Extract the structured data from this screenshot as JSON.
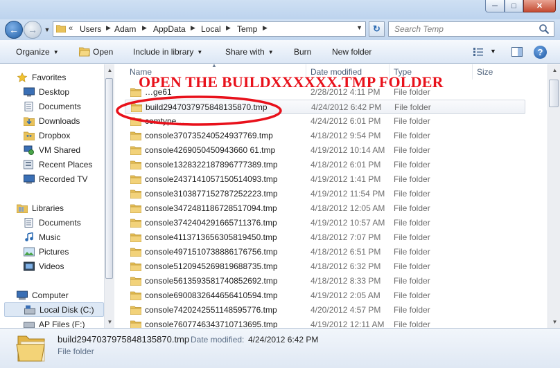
{
  "colors": {
    "annotation": "#e8111b",
    "folder": "#e9c25a",
    "chrome": "#c9dcf2"
  },
  "window": {
    "min_icon": "minimize-icon",
    "max_icon": "maximize-icon",
    "close_icon": "close-icon"
  },
  "address": {
    "overflow": "«",
    "crumbs": [
      "Users",
      "Adam",
      "AppData",
      "Local",
      "Temp"
    ]
  },
  "search": {
    "placeholder": "Search Temp"
  },
  "toolbar": {
    "organize": "Organize",
    "open": "Open",
    "include": "Include in library",
    "share": "Share with",
    "burn": "Burn",
    "new_folder": "New folder"
  },
  "nav": {
    "favorites": {
      "header": "Favorites",
      "items": [
        "Desktop",
        "Documents",
        "Downloads",
        "Dropbox",
        "VM Shared",
        "Recent Places",
        "Recorded TV"
      ]
    },
    "libraries": {
      "header": "Libraries",
      "items": [
        "Documents",
        "Music",
        "Pictures",
        "Videos"
      ]
    },
    "computer": {
      "header": "Computer",
      "items": [
        "Local Disk (C:)",
        "AP Files (F:)"
      ]
    }
  },
  "columns": {
    "name": "Name",
    "date": "Date modified",
    "type": "Type",
    "size": "Size"
  },
  "annotation": "OPEN THE BUILDXXXXXX.TMP FOLDER",
  "files": [
    {
      "name": "…ge61",
      "date": "2/28/2012 4:11 PM",
      "type": "File folder"
    },
    {
      "name": "build2947037975848135870.tmp",
      "date": "4/24/2012 6:42 PM",
      "type": "File folder"
    },
    {
      "name": "comtype…",
      "date": "4/24/2012 6:01 PM",
      "type": "File folder"
    },
    {
      "name": "console370735240524937769.tmp",
      "date": "4/18/2012 9:54 PM",
      "type": "File folder"
    },
    {
      "name": "console4269050450943660 61.tmp",
      "date": "4/19/2012 10:14 AM",
      "type": "File folder"
    },
    {
      "name": "console1328322187896777389.tmp",
      "date": "4/18/2012 6:01 PM",
      "type": "File folder"
    },
    {
      "name": "console2437141057150514093.tmp",
      "date": "4/19/2012 1:41 PM",
      "type": "File folder"
    },
    {
      "name": "console3103877152787252223.tmp",
      "date": "4/19/2012 11:54 PM",
      "type": "File folder"
    },
    {
      "name": "console3472481186728517094.tmp",
      "date": "4/18/2012 12:05 AM",
      "type": "File folder"
    },
    {
      "name": "console3742404291665711376.tmp",
      "date": "4/19/2012 10:57 AM",
      "type": "File folder"
    },
    {
      "name": "console4113713656305819450.tmp",
      "date": "4/18/2012 7:07 PM",
      "type": "File folder"
    },
    {
      "name": "console4971510738886176756.tmp",
      "date": "4/18/2012 6:51 PM",
      "type": "File folder"
    },
    {
      "name": "console5120945269819688735.tmp",
      "date": "4/18/2012 6:32 PM",
      "type": "File folder"
    },
    {
      "name": "console5613593581740852692.tmp",
      "date": "4/18/2012 8:33 PM",
      "type": "File folder"
    },
    {
      "name": "console6900832644656410594.tmp",
      "date": "4/19/2012 2:05 AM",
      "type": "File folder"
    },
    {
      "name": "console7420242551148595776.tmp",
      "date": "4/20/2012 4:57 PM",
      "type": "File folder"
    },
    {
      "name": "console7607746343710713695.tmp",
      "date": "4/19/2012 12:11 AM",
      "type": "File folder"
    }
  ],
  "details": {
    "name": "build2947037975848135870.tmp",
    "date_label": "Date modified:",
    "date": "4/24/2012 6:42 PM",
    "type": "File folder"
  }
}
